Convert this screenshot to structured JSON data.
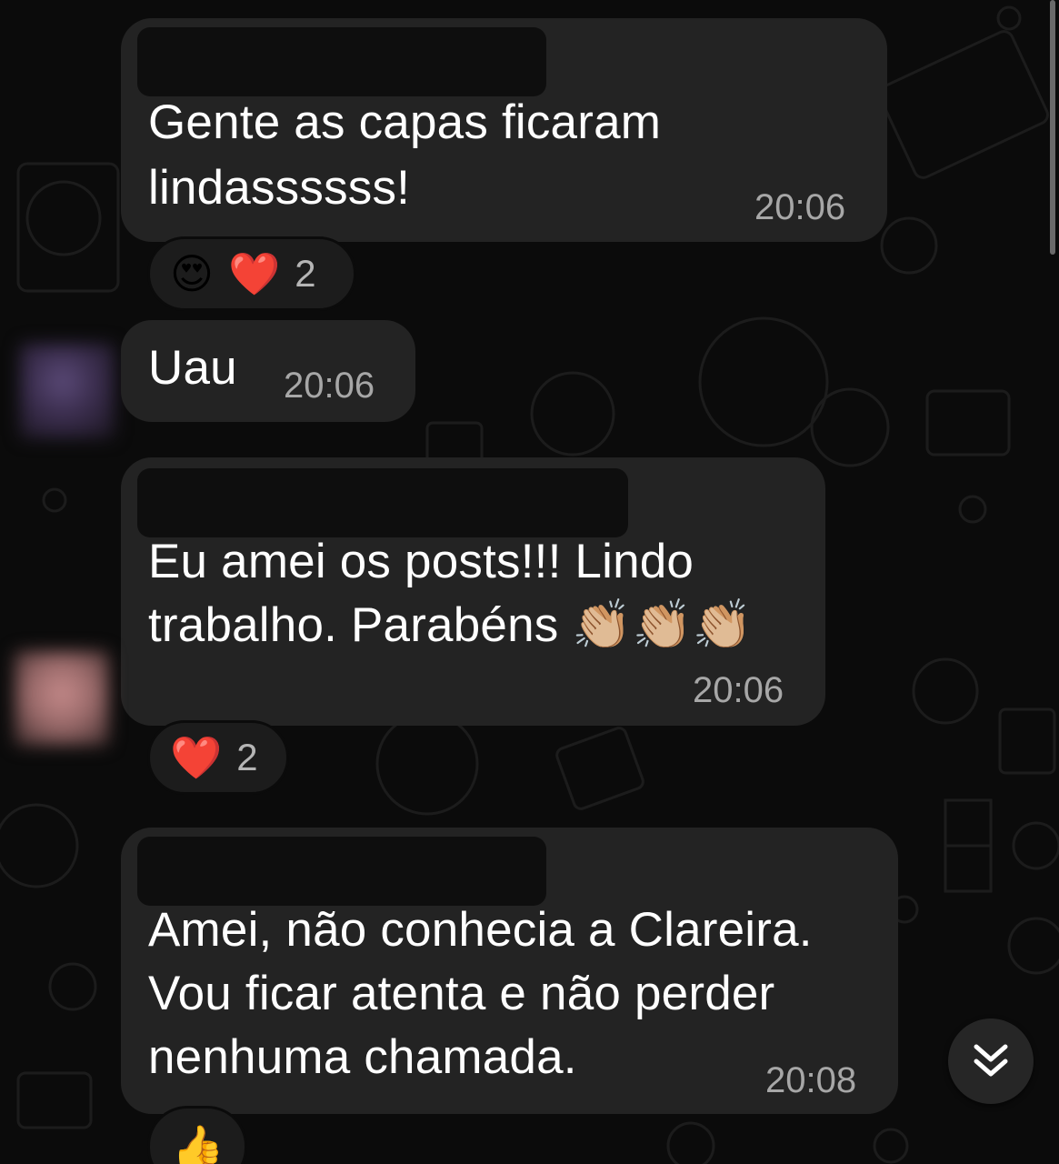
{
  "messages": [
    {
      "lines": [
        "Gente as capas ficaram",
        "lindassssss!"
      ],
      "time": "20:06",
      "reactions": {
        "emojis": [
          "😍",
          "❤️"
        ],
        "count": "2"
      }
    },
    {
      "lines": [
        "Uau"
      ],
      "time": "20:06"
    },
    {
      "lines": [
        "Eu amei os posts!!! Lindo",
        "trabalho. Parabéns 👏🏼👏🏼👏🏼"
      ],
      "time": "20:06",
      "reactions": {
        "emojis": [
          "❤️"
        ],
        "count": "2"
      }
    },
    {
      "lines": [
        "Amei, não conhecia a Clareira.",
        "Vou ficar atenta e não perder",
        "nenhuma chamada."
      ],
      "time": "20:08",
      "reactions": {
        "emojis": [
          "👍"
        ]
      }
    }
  ],
  "icons": {
    "scroll_down": "double-chevron-down-icon"
  },
  "colors": {
    "background": "#0b0b0b",
    "bubble": "#232323",
    "time_text": "#a7a7a7",
    "message_text": "#ffffff"
  }
}
